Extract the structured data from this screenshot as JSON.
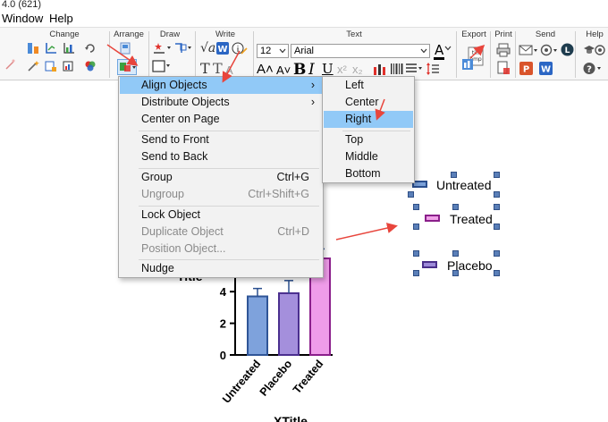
{
  "title_bar": {
    "text": "4.0 (621)"
  },
  "menubar": {
    "items": [
      "Window",
      "Help"
    ]
  },
  "ribbon": {
    "groups": [
      "Change",
      "Arrange",
      "Draw",
      "Write",
      "Text",
      "Export",
      "Print",
      "Send",
      "Help"
    ],
    "font_size": "12",
    "font_name": "Arial",
    "colors": {
      "red": "#e0302a",
      "blue": "#2b66c4",
      "green": "#3aa040",
      "orange": "#f08a24",
      "purple": "#7b3fa6",
      "dark_teal": "#1e3c4e"
    }
  },
  "arrange_menu": {
    "items": [
      {
        "label": "Align Objects",
        "shortcut": "",
        "disabled": false,
        "submenu": true,
        "highlighted": true
      },
      {
        "label": "Distribute Objects",
        "shortcut": "",
        "disabled": false,
        "submenu": true
      },
      {
        "label": "Center on Page",
        "shortcut": "",
        "disabled": false
      },
      {
        "label": "Send to Front",
        "shortcut": "",
        "disabled": false
      },
      {
        "label": "Send to Back",
        "shortcut": "",
        "disabled": false
      },
      {
        "label": "Group",
        "shortcut": "Ctrl+G",
        "disabled": false
      },
      {
        "label": "Ungroup",
        "shortcut": "Ctrl+Shift+G",
        "disabled": true
      },
      {
        "label": "Lock Object",
        "shortcut": "",
        "disabled": false
      },
      {
        "label": "Duplicate Object",
        "shortcut": "Ctrl+D",
        "disabled": true
      },
      {
        "label": "Position Object...",
        "shortcut": "",
        "disabled": true
      },
      {
        "label": "Nudge",
        "shortcut": "",
        "disabled": false
      }
    ]
  },
  "align_submenu": {
    "items": [
      {
        "label": "Left"
      },
      {
        "label": "Center"
      },
      {
        "label": "Right",
        "highlighted": true
      },
      {
        "label": "Top"
      },
      {
        "label": "Middle"
      },
      {
        "label": "Bottom"
      }
    ]
  },
  "legend": {
    "entries": [
      {
        "label": "Untreated",
        "fill": "#7aa0d8",
        "stroke": "#2a4f8f"
      },
      {
        "label": "Treated",
        "fill": "#f0a0e8",
        "stroke": "#8a1f8a"
      },
      {
        "label": "Placebo",
        "fill": "#9d8ad8",
        "stroke": "#4a2f8a"
      }
    ]
  },
  "chart_data": {
    "type": "bar",
    "categories": [
      "Untreated",
      "Placebo",
      "Treated"
    ],
    "values": [
      3.7,
      3.9,
      6.1
    ],
    "errors": [
      0.5,
      0.8,
      0.6
    ],
    "colors": [
      "#7ea2dc",
      "#a48fdc",
      "#ef9ce9"
    ],
    "strokes": [
      "#2f5597",
      "#4b2f8f",
      "#8b1f8b"
    ],
    "yticks": [
      "0",
      "2",
      "4"
    ],
    "ylim": [
      0,
      7
    ],
    "ylabel": "Title",
    "xlabel": "XTitle"
  }
}
